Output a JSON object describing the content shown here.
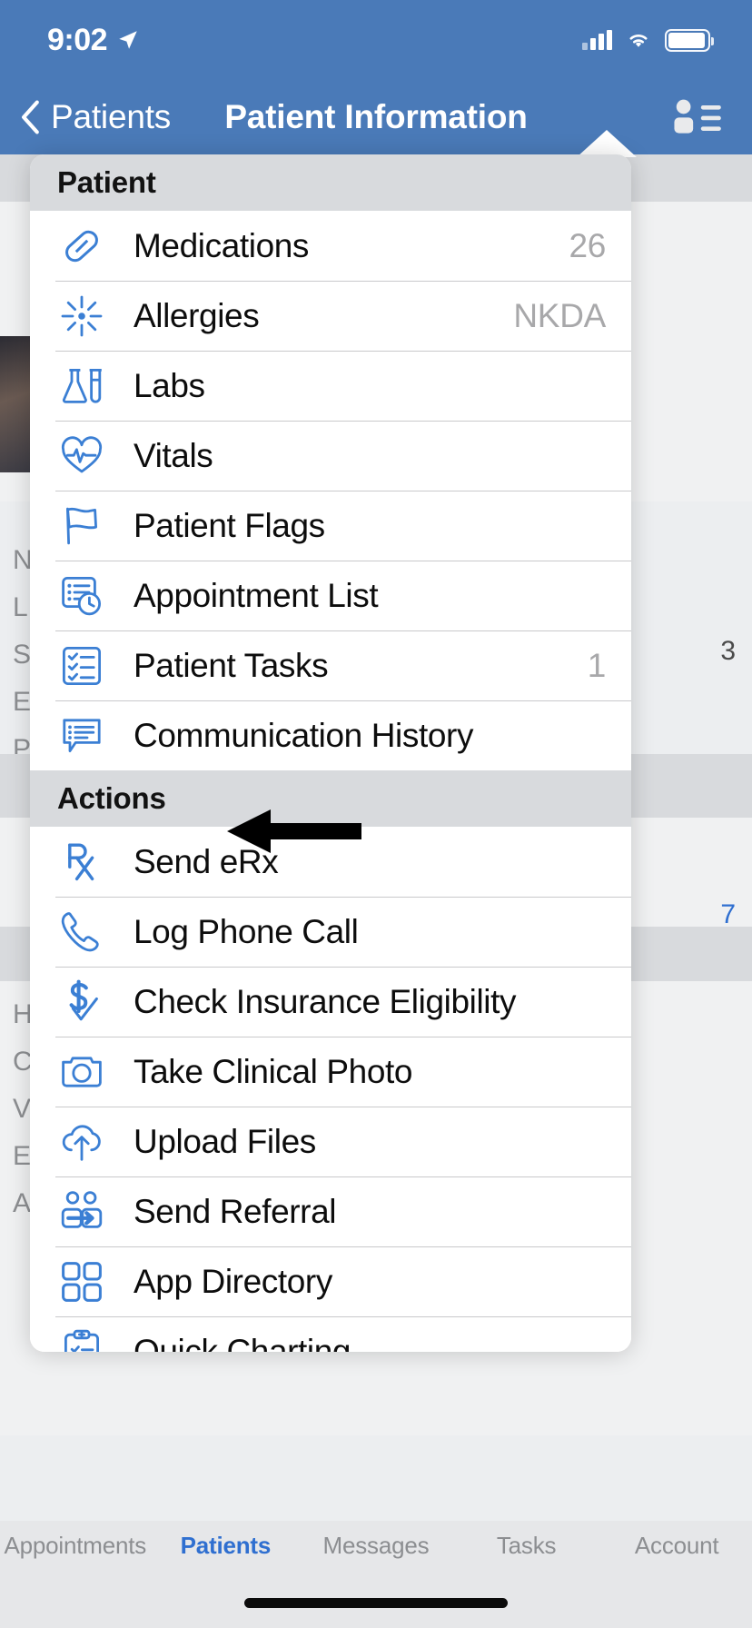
{
  "status_bar": {
    "time": "9:02",
    "location_icon": "location-arrow-icon",
    "signal_icon": "cellular-signal-icon",
    "wifi_icon": "wifi-icon",
    "battery_icon": "battery-icon"
  },
  "nav_bar": {
    "back_label": "Patients",
    "title": "Patient Information",
    "menu_icon": "person-list-icon"
  },
  "popover": {
    "sections": [
      {
        "header": "Patient",
        "items": [
          {
            "icon": "pill-icon",
            "label": "Medications",
            "value": "26"
          },
          {
            "icon": "allergy-burst-icon",
            "label": "Allergies",
            "value": "NKDA"
          },
          {
            "icon": "lab-flask-icon",
            "label": "Labs",
            "value": ""
          },
          {
            "icon": "heart-pulse-icon",
            "label": "Vitals",
            "value": ""
          },
          {
            "icon": "flag-icon",
            "label": "Patient Flags",
            "value": ""
          },
          {
            "icon": "appointment-clock-icon",
            "label": "Appointment List",
            "value": ""
          },
          {
            "icon": "checklist-icon",
            "label": "Patient Tasks",
            "value": "1"
          },
          {
            "icon": "chat-list-icon",
            "label": "Communication History",
            "value": ""
          }
        ]
      },
      {
        "header": "Actions",
        "items": [
          {
            "icon": "rx-icon",
            "label": "Send eRx",
            "value": ""
          },
          {
            "icon": "phone-icon",
            "label": "Log Phone Call",
            "value": ""
          },
          {
            "icon": "dollar-check-icon",
            "label": "Check Insurance Eligibility",
            "value": ""
          },
          {
            "icon": "camera-icon",
            "label": "Take Clinical Photo",
            "value": ""
          },
          {
            "icon": "cloud-upload-icon",
            "label": "Upload Files",
            "value": ""
          },
          {
            "icon": "referral-icon",
            "label": "Send Referral",
            "value": ""
          },
          {
            "icon": "grid-apps-icon",
            "label": "App Directory",
            "value": ""
          },
          {
            "icon": "clipboard-chart-icon",
            "label": "Quick Charting",
            "value": ""
          }
        ]
      }
    ]
  },
  "annotation": {
    "arrow_icon": "left-pointing-arrow-annotation",
    "target_label": "Send eRx"
  },
  "background": {
    "right_values": [
      "3",
      "7"
    ],
    "left_fragments": [
      "N",
      "L",
      "S",
      "E",
      "P",
      "H",
      "C",
      "V",
      "E",
      "A"
    ]
  },
  "tab_bar": {
    "tabs": [
      {
        "label": "Appointments",
        "active": false
      },
      {
        "label": "Patients",
        "active": true
      },
      {
        "label": "Messages",
        "active": false
      },
      {
        "label": "Tasks",
        "active": false
      },
      {
        "label": "Account",
        "active": false
      }
    ]
  },
  "colors": {
    "nav_blue": "#4a7ab8",
    "accent_blue": "#2f6fd0",
    "icon_blue": "#3b7fd4",
    "section_gray": "#d8dadd",
    "page_gray": "#eceef0"
  }
}
